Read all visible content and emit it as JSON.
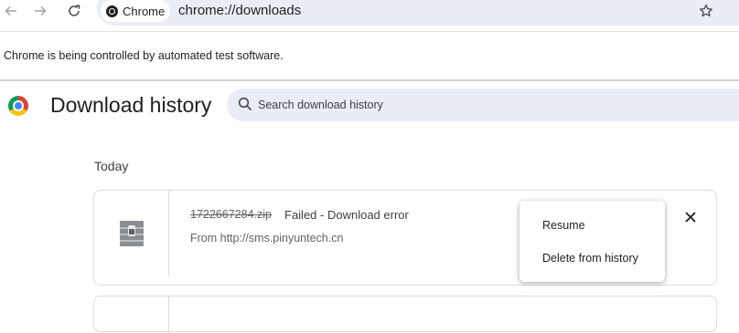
{
  "toolbar": {
    "chip_label": "Chrome",
    "url": "chrome://downloads"
  },
  "infobar": {
    "message": "Chrome is being controlled by automated test software."
  },
  "header": {
    "title": "Download history",
    "search_placeholder": "Search download history"
  },
  "section": {
    "label": "Today"
  },
  "downloads": [
    {
      "filename": "1722667284.zip",
      "status": "Failed - Download error",
      "source": "From http://sms.pinyuntech.cn"
    }
  ],
  "context_menu": {
    "items": [
      "Resume",
      "Delete from history"
    ]
  },
  "icons": {
    "back": "arrow-left-icon",
    "forward": "arrow-right-icon",
    "reload": "reload-icon",
    "bookmark": "star-icon",
    "search": "search-icon",
    "close": "close-icon",
    "file": "archive-file-icon"
  },
  "colors": {
    "omnibox": "#e9eef6",
    "text": "#1f1f1f",
    "muted": "#5f6368",
    "border": "#dadce0"
  }
}
